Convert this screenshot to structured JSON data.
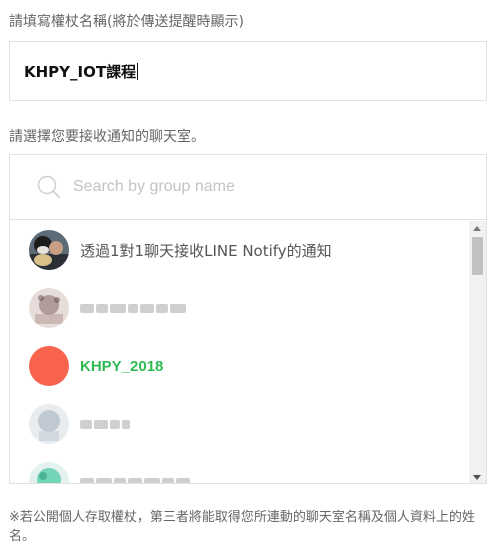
{
  "token_name": {
    "label": "請填寫權杖名稱(將於傳送提醒時顯示)",
    "value": "KHPY_IOT課程"
  },
  "chat_select": {
    "label": "請選擇您要接收通知的聊天室。",
    "search_placeholder": "Search by group name",
    "items": [
      {
        "name": "透過1對1聊天接收LINE Notify的通知",
        "avatar": "photo-icon"
      },
      {
        "name": "",
        "avatar": "blurred-photo-icon"
      },
      {
        "name": "KHPY_2018",
        "avatar": "group-icon",
        "avatar_color": "#f8634e",
        "selected_color": "#2dbb52"
      },
      {
        "name": "",
        "avatar": "blurred-photo-icon"
      },
      {
        "name": "",
        "avatar": "blurred-photo-icon"
      }
    ]
  },
  "notice": "※若公開個人存取權杖，第三者將能取得您所連動的聊天室名稱及個人資料上的姓名。"
}
